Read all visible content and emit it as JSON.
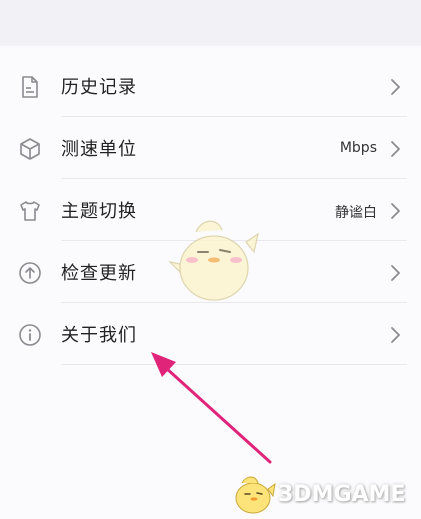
{
  "menu": {
    "items": [
      {
        "label": "历史记录",
        "value": "",
        "icon": "document-icon"
      },
      {
        "label": "测速单位",
        "value": "Mbps",
        "icon": "cube-icon"
      },
      {
        "label": "主题切换",
        "value": "静谧白",
        "icon": "tshirt-icon"
      },
      {
        "label": "检查更新",
        "value": "",
        "icon": "upload-circle-icon"
      },
      {
        "label": "关于我们",
        "value": "",
        "icon": "info-circle-icon"
      }
    ]
  },
  "colors": {
    "icon_gray": "#8a8a90",
    "divider": "#e8e8ee",
    "arrow": "#e0247a",
    "background": "#fbfbfd"
  },
  "watermark": {
    "text": "3DMGAME"
  }
}
